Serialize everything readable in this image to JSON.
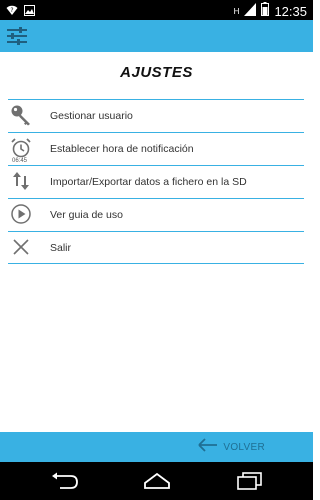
{
  "status_bar": {
    "time": "12:35",
    "network": "H",
    "icons": [
      "wifi-question-icon",
      "image-icon",
      "signal-icon",
      "battery-icon"
    ]
  },
  "app_bar": {
    "icon": "settings-sliders-icon",
    "color": "#39b1e3"
  },
  "title": "AJUSTES",
  "menu": {
    "items": [
      {
        "label": "Gestionar usuario",
        "icon": "key-icon"
      },
      {
        "label": "Establecer hora de notificación",
        "icon": "alarm-clock-icon",
        "subtext": "06:45"
      },
      {
        "label": "Importar/Exportar datos a fichero en la SD",
        "icon": "import-export-icon"
      },
      {
        "label": "Ver guia de uso",
        "icon": "play-icon"
      },
      {
        "label": "Salir",
        "icon": "close-icon"
      }
    ]
  },
  "bottom_bar": {
    "back_label": "VOLVER",
    "back_icon": "arrow-left-icon"
  },
  "nav_bar": {
    "buttons": [
      "back-nav-icon",
      "home-nav-icon",
      "recents-nav-icon"
    ]
  }
}
